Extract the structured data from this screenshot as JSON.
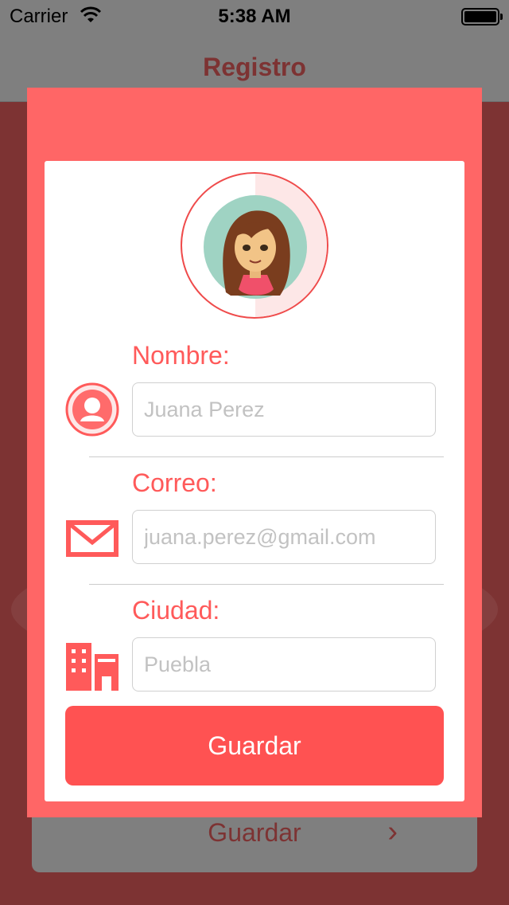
{
  "status_bar": {
    "carrier": "Carrier",
    "time": "5:38 AM"
  },
  "nav": {
    "title": "Registro"
  },
  "background_screen": {
    "button_label": "Guardar",
    "chevron": "›"
  },
  "form": {
    "avatar_icon": "girl-avatar-icon",
    "fields": [
      {
        "label": "Nombre:",
        "placeholder": "Juana Perez",
        "icon": "user-icon"
      },
      {
        "label": "Correo:",
        "placeholder": "juana.perez@gmail.com",
        "icon": "envelope-icon"
      },
      {
        "label": "Ciudad:",
        "placeholder": "Puebla",
        "icon": "city-icon"
      }
    ],
    "save_label": "Guardar"
  },
  "colors": {
    "modal": "#ff6666",
    "accent": "#ff5252",
    "label": "#ff5a5a",
    "dimmed_background": "#7d3333",
    "nav_bar": "#7f7f7f"
  }
}
